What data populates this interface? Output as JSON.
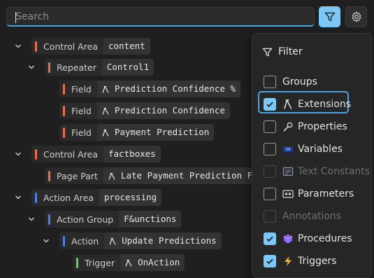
{
  "search": {
    "placeholder": "Search"
  },
  "toolbar": {
    "filter_icon": "funnel-icon",
    "settings_icon": "gear-icon"
  },
  "colors": {
    "control_area": "#e8704f",
    "repeater": "#e8704f",
    "field": "#e8704f",
    "page_part": "#e8704f",
    "action_area": "#4f7ee8",
    "action_group": "#4f7ee8",
    "action": "#4f7ee8",
    "trigger": "#5fd35f",
    "accent": "#7cc7f5"
  },
  "tree": [
    {
      "kind": "Control Area",
      "name": "content",
      "ext": false
    },
    {
      "kind": "Repeater",
      "name": "Control1",
      "ext": false
    },
    {
      "kind": "Field",
      "name": "Prediction Confidence %",
      "ext": true
    },
    {
      "kind": "Field",
      "name": "Prediction Confidence",
      "ext": true
    },
    {
      "kind": "Field",
      "name": "Payment Prediction",
      "ext": true
    },
    {
      "kind": "Control Area",
      "name": "factboxes",
      "ext": false
    },
    {
      "kind": "Page Part",
      "name": "Late Payment Prediction Fact",
      "ext": true
    },
    {
      "kind": "Action Area",
      "name": "processing",
      "ext": false
    },
    {
      "kind": "Action Group",
      "name": "F&unctions",
      "ext": false
    },
    {
      "kind": "Action",
      "name": "Update Predictions",
      "ext": true
    },
    {
      "kind": "Trigger",
      "name": "OnAction",
      "ext": true
    }
  ],
  "filter": {
    "title": "Filter",
    "options": [
      {
        "label": "Groups",
        "checked": false,
        "disabled": false,
        "icon": ""
      },
      {
        "label": "Extensions",
        "checked": true,
        "disabled": false,
        "icon": "extension-icon"
      },
      {
        "label": "Properties",
        "checked": false,
        "disabled": false,
        "icon": "wrench-icon"
      },
      {
        "label": "Variables",
        "checked": false,
        "disabled": false,
        "icon": "variable-icon"
      },
      {
        "label": "Text Constants",
        "checked": false,
        "disabled": true,
        "icon": "text-constant-icon"
      },
      {
        "label": "Parameters",
        "checked": false,
        "disabled": false,
        "icon": "parameter-icon"
      },
      {
        "label": "Annotations",
        "checked": false,
        "disabled": true,
        "icon": ""
      },
      {
        "label": "Procedures",
        "checked": true,
        "disabled": false,
        "icon": "cube-icon"
      },
      {
        "label": "Triggers",
        "checked": true,
        "disabled": false,
        "icon": "lightning-icon"
      }
    ]
  }
}
